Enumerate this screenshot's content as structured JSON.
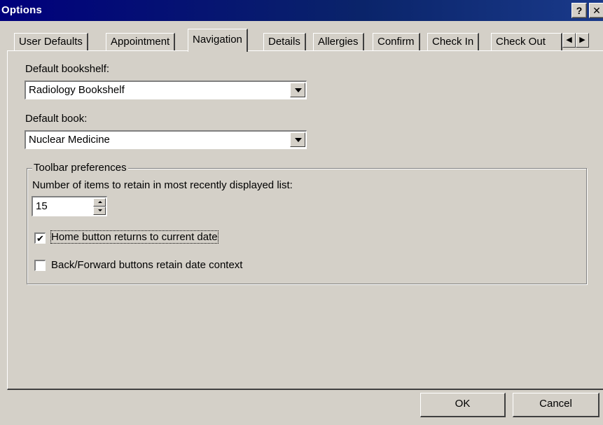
{
  "window": {
    "title": "Options",
    "help_button": "?",
    "close_button": "✕"
  },
  "tabs": [
    {
      "label": "User Defaults"
    },
    {
      "label": "Appointment"
    },
    {
      "label": "Navigation",
      "active": true
    },
    {
      "label": "Details"
    },
    {
      "label": "Allergies"
    },
    {
      "label": "Confirm"
    },
    {
      "label": "Check In"
    },
    {
      "label": "Check Out"
    }
  ],
  "tab_scroll": {
    "left": "◀",
    "right": "▶"
  },
  "bookshelf": {
    "label": "Default bookshelf:",
    "value": "Radiology Bookshelf"
  },
  "book": {
    "label": "Default book:",
    "value": "Nuclear Medicine"
  },
  "toolbar_prefs": {
    "group_label": "Toolbar preferences",
    "mru_label": "Number of items to retain in most recently displayed list:",
    "mru_value": "15",
    "home_button": {
      "label": "Home button returns to current date",
      "checked": true,
      "check_glyph": "✔"
    },
    "back_forward": {
      "label": "Back/Forward buttons retain date context",
      "checked": false
    }
  },
  "buttons": {
    "ok": "OK",
    "cancel": "Cancel"
  }
}
